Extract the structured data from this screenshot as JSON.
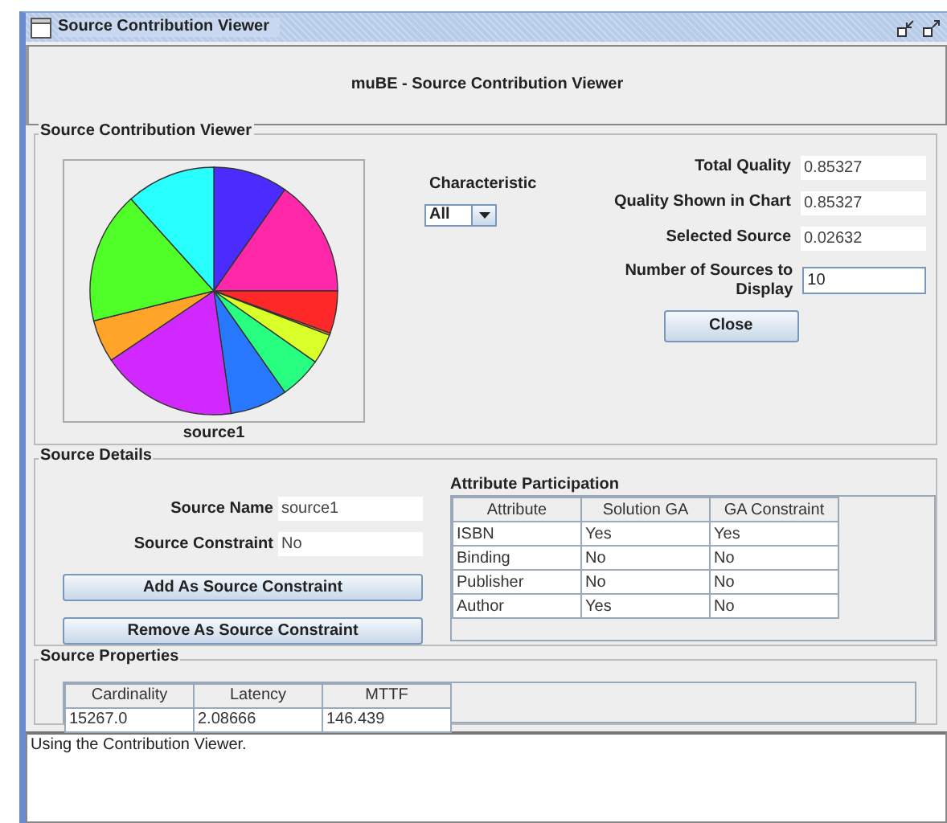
{
  "window": {
    "title": "Source Contribution Viewer"
  },
  "header": {
    "title": "muBE - Source Contribution Viewer"
  },
  "contribution_viewer": {
    "title": "Source Contribution Viewer",
    "chart_caption": "source1",
    "characteristic": {
      "label": "Characteristic",
      "value": "All"
    },
    "stats": [
      {
        "label": "Total Quality",
        "value": "0.85327",
        "kind": "readonly"
      },
      {
        "label": "Quality Shown in Chart",
        "value": "0.85327",
        "kind": "readonly"
      },
      {
        "label": "Selected Source",
        "value": "0.02632",
        "kind": "readonly"
      },
      {
        "label": "Number of Sources to Display",
        "value": "10",
        "kind": "input"
      }
    ],
    "close_button": "Close"
  },
  "source_details": {
    "title": "Source Details",
    "fields": [
      {
        "label": "Source Name",
        "value": "source1"
      },
      {
        "label": "Source Constraint",
        "value": "No"
      }
    ],
    "buttons": [
      "Add As Source Constraint",
      "Remove As Source Constraint"
    ],
    "attribute_participation": {
      "title": "Attribute Participation",
      "columns": [
        "Attribute",
        "Solution GA",
        "GA Constraint"
      ],
      "rows": [
        [
          "ISBN",
          "Yes",
          "Yes"
        ],
        [
          "Binding",
          "No",
          "No"
        ],
        [
          "Publisher",
          "No",
          "No"
        ],
        [
          "Author",
          "Yes",
          "No"
        ]
      ]
    }
  },
  "source_properties": {
    "title": "Source Properties",
    "columns": [
      "Cardinality",
      "Latency",
      "MTTF"
    ],
    "rows": [
      [
        "15267.0",
        "2.08666",
        "146.439"
      ]
    ]
  },
  "log": {
    "text": "Using the Contribution Viewer."
  }
}
